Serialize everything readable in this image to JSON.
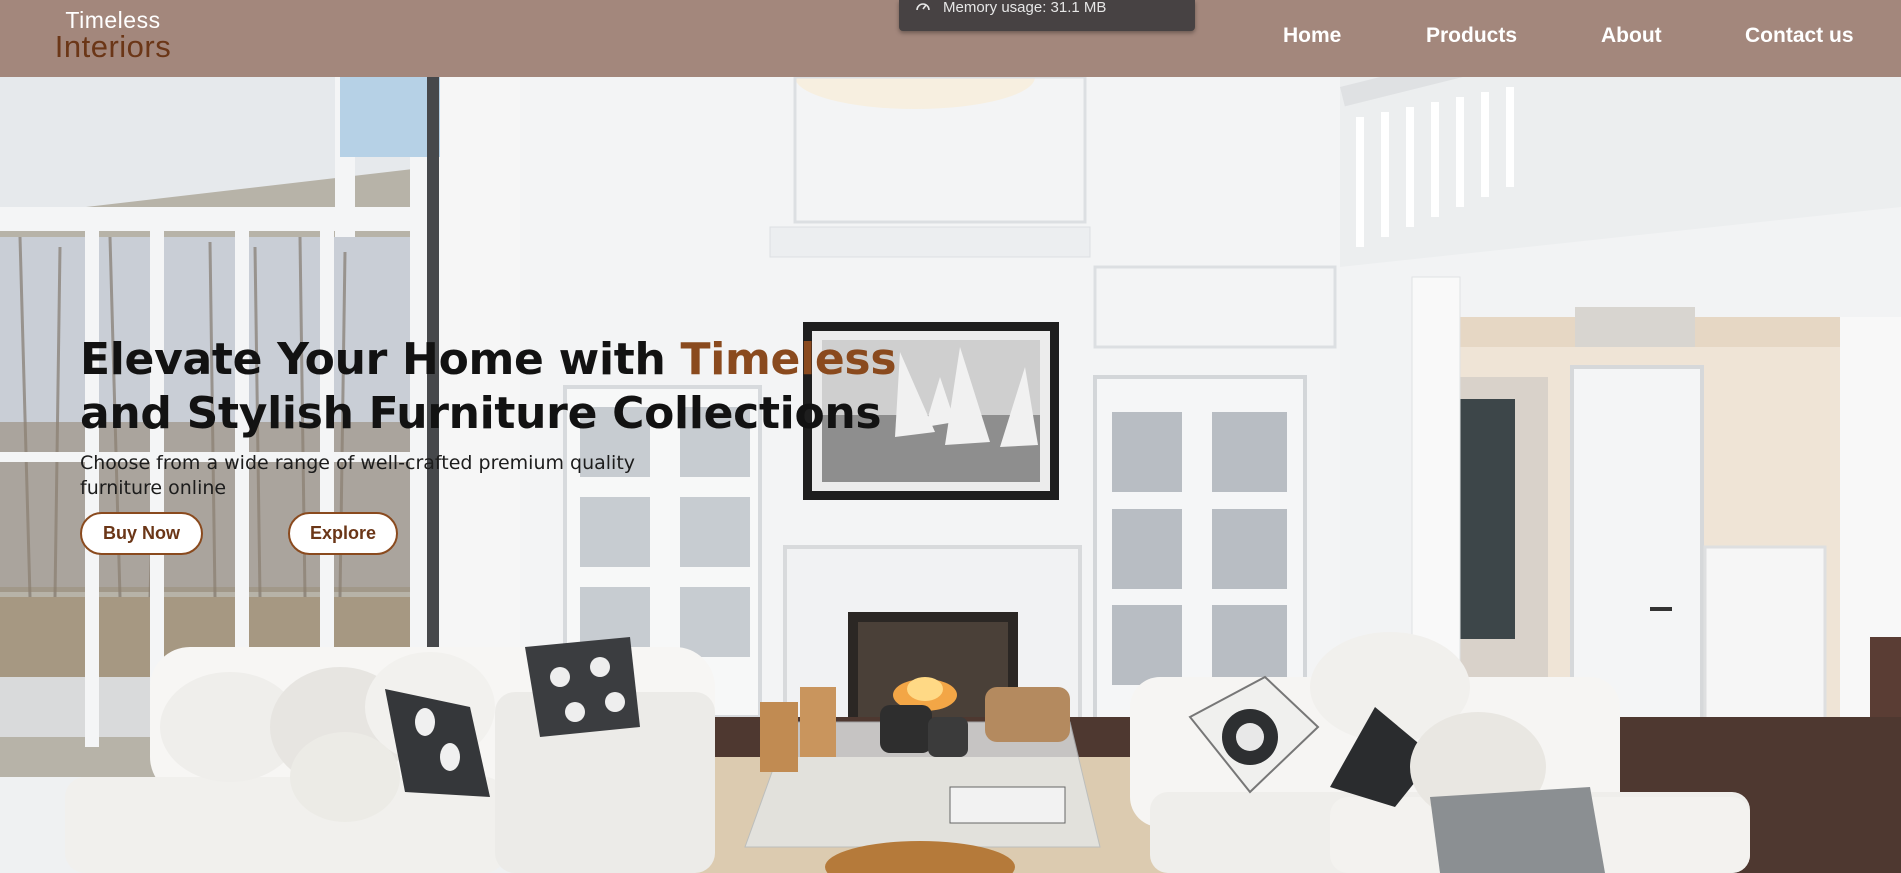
{
  "brand": {
    "line1": "Timeless",
    "line2": "Interiors",
    "accent_color": "#8a4a1e",
    "header_color": "#a3877c"
  },
  "nav": {
    "items": [
      {
        "label": "Home"
      },
      {
        "label": "Products"
      },
      {
        "label": "About"
      },
      {
        "label": "Contact us"
      }
    ]
  },
  "toast": {
    "icon": "gauge-icon",
    "text": "Memory usage: 31.1 MB"
  },
  "hero": {
    "headline_part1": "Elevate Your Home with ",
    "headline_accent": "Timeless",
    "headline_part2": "and Stylish Furniture Collections",
    "subtitle": "Choose from a wide range of well-crafted premium quality furniture online",
    "buy_label": "Buy Now",
    "explore_label": "Explore"
  }
}
